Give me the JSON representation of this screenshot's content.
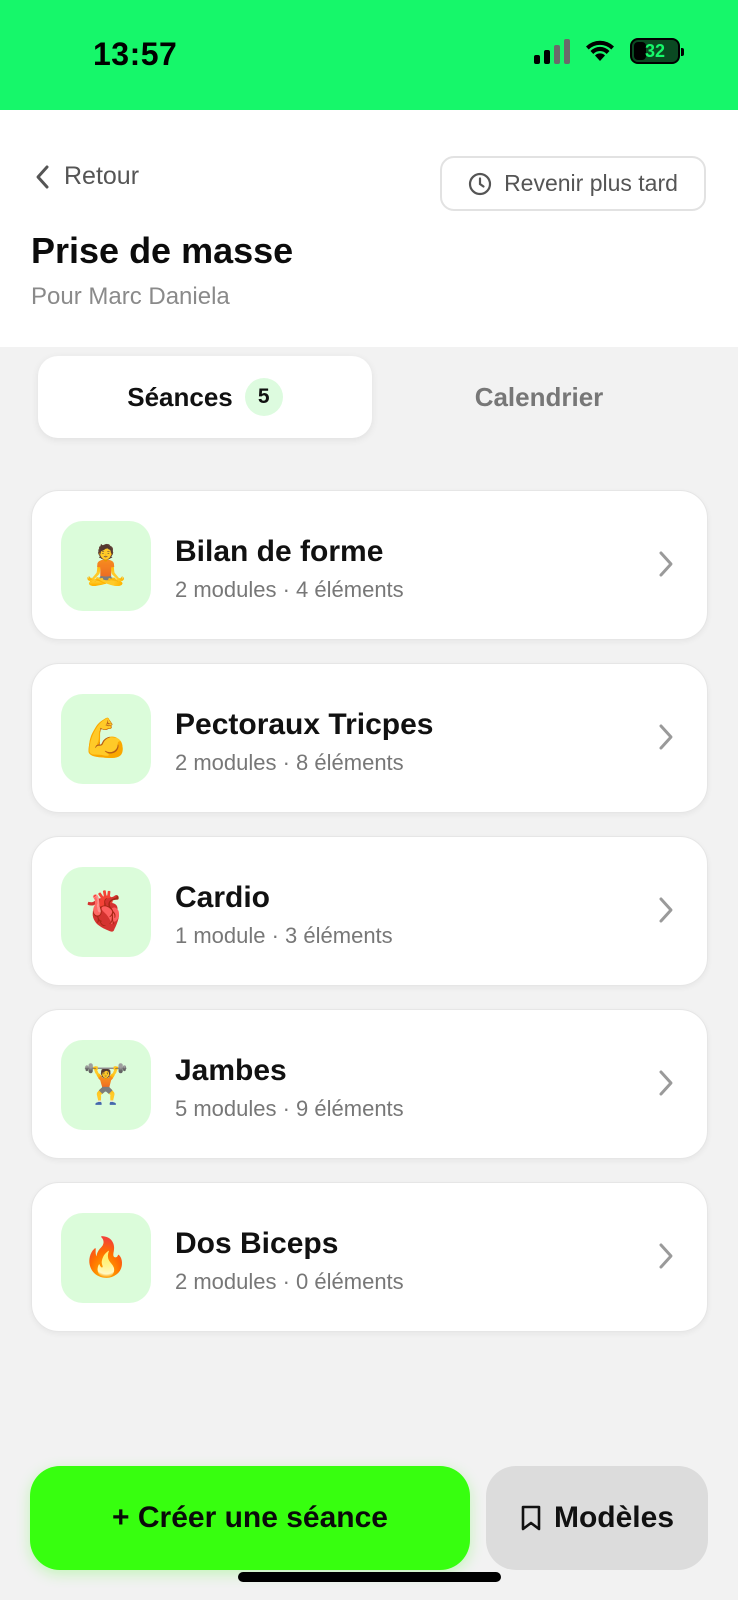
{
  "status_bar": {
    "time": "13:57",
    "battery": "32"
  },
  "header": {
    "back_label": "Retour",
    "later_label": "Revenir plus tard",
    "title": "Prise de masse",
    "subtitle": "Pour Marc Daniela"
  },
  "tabs": [
    {
      "label": "Séances",
      "count": "5",
      "active": true
    },
    {
      "label": "Calendrier",
      "active": false
    }
  ],
  "sessions": [
    {
      "emoji": "🧘",
      "icon": "meditation-icon",
      "name": "Bilan de forme",
      "meta": "2 modules · 4 éléments"
    },
    {
      "emoji": "💪",
      "icon": "flexed-bicep-icon",
      "name": "Pectoraux Tricpes",
      "meta": "2 modules · 8 éléments"
    },
    {
      "emoji": "🫀",
      "icon": "anatomical-heart-icon",
      "name": "Cardio",
      "meta": "1 module · 3 éléments"
    },
    {
      "emoji": "🏋️",
      "icon": "weightlifter-icon",
      "name": "Jambes",
      "meta": "5 modules · 9 éléments"
    },
    {
      "emoji": "🔥",
      "icon": "fire-icon",
      "name": "Dos Biceps",
      "meta": "2 modules · 0 éléments"
    }
  ],
  "actions": {
    "create_label": "+ Créer une séance",
    "templates_label": "Modèles"
  },
  "colors": {
    "status_bar": "#16f76a",
    "primary_button": "#37ff0f",
    "icon_background": "#dbfcda"
  }
}
